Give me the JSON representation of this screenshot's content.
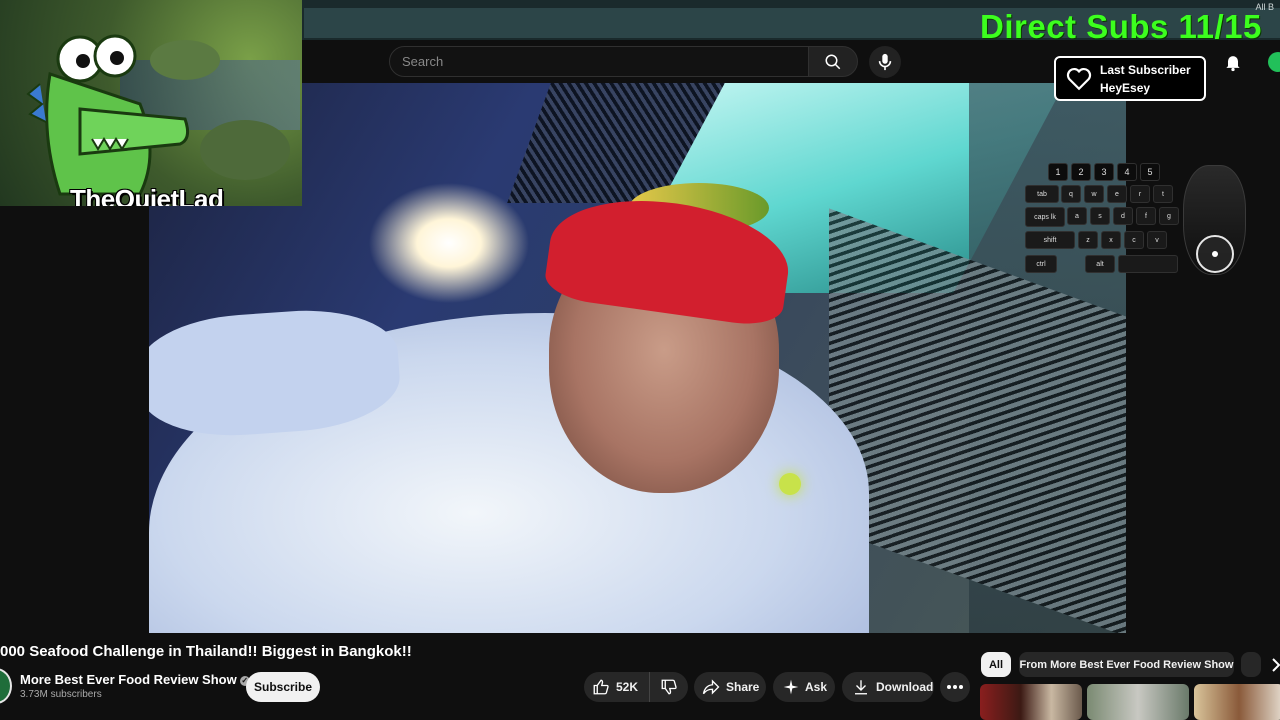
{
  "browser": {
    "bookmarks_label": "All B"
  },
  "header": {
    "search_placeholder": "Search"
  },
  "overlay": {
    "direct_subs": "Direct Subs 11/15",
    "last_subscriber_label": "Last Subscriber",
    "last_subscriber_name": "HeyEsey",
    "streamer_name": "TheQuietLad",
    "keyboard": {
      "numbers": [
        "1",
        "2",
        "3",
        "4",
        "5"
      ],
      "row_tab": [
        "tab",
        "q",
        "w",
        "e",
        "r",
        "t"
      ],
      "row_caps": [
        "caps lk",
        "a",
        "s",
        "d",
        "f",
        "g"
      ],
      "row_shift": [
        "shift",
        "z",
        "x",
        "c",
        "v"
      ],
      "row_ctrl": [
        "ctrl",
        "alt"
      ]
    }
  },
  "video": {
    "title": "000 Seafood Challenge in Thailand!! Biggest in Bangkok!!",
    "channel_name": "More Best Ever Food Review Show",
    "subscriber_count": "3.73M subscribers",
    "subscribe_label": "Subscribe",
    "likes": "52K",
    "share_label": "Share",
    "ask_label": "Ask",
    "download_label": "Download"
  },
  "recommendations": {
    "chips": [
      "All",
      "From More Best Ever Food Review Show"
    ]
  }
}
